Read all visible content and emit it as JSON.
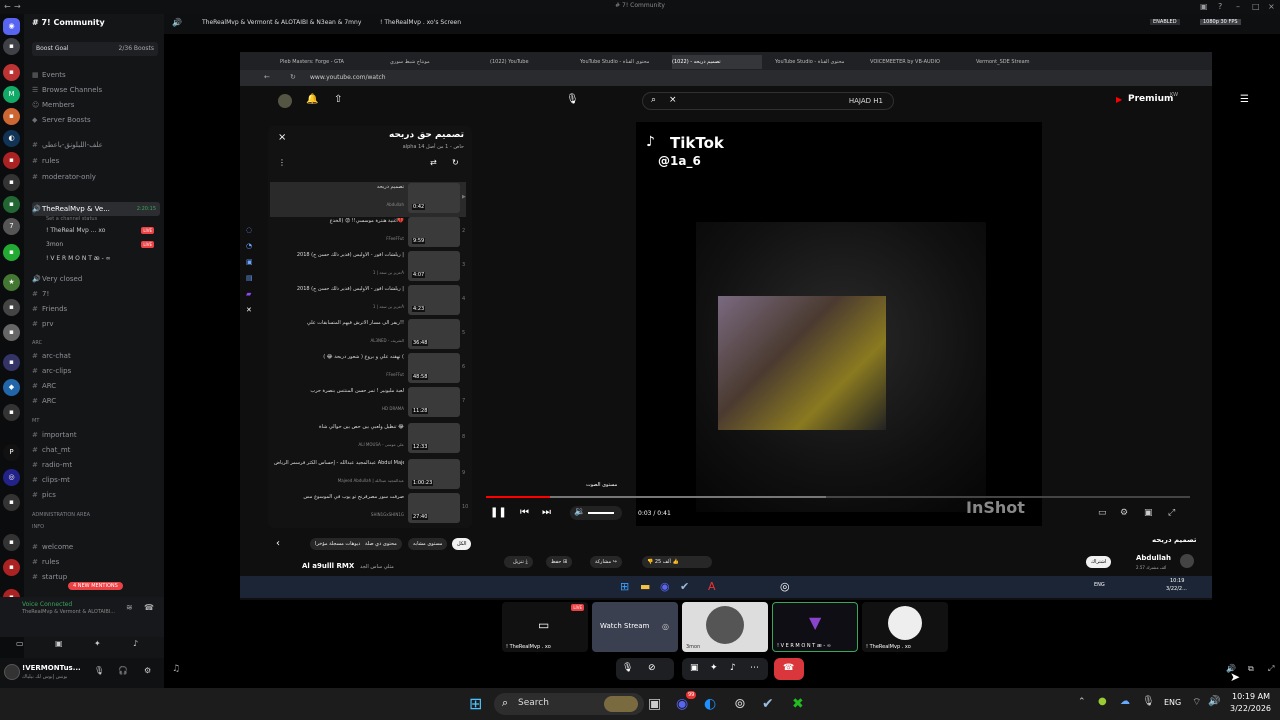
{
  "window": {
    "title": "# 7! Community"
  },
  "sidebar": {
    "guild_name": "# 7! Community",
    "boost_goal": "Boost Goal",
    "boost_count": "2/36 Boosts",
    "items": [
      {
        "label": "Events",
        "sym": "▦"
      },
      {
        "label": "Browse Channels",
        "sym": "☰"
      },
      {
        "label": "Members",
        "sym": "👥"
      },
      {
        "label": "Server Boosts",
        "sym": "◆"
      }
    ],
    "channels_top": [
      "علف-اللبلونق-باعطي",
      "rules",
      "moderator-only"
    ],
    "voice_channel": "TheRealMvp & Ve...",
    "voice_time": "2:20:15",
    "voice_status": "Set a channel status",
    "voice_users": [
      {
        "name": "! TheReal Mvp ... xo",
        "live": "LIVE"
      },
      {
        "name": "3mon",
        "live": "LIVE"
      },
      {
        "name": "! V E R M O N T æ - ∞",
        "live": ""
      }
    ],
    "channels_mid": [
      "Very closed",
      "7!",
      "Friends",
      "prv"
    ],
    "cat_arc": "ARC",
    "channels_arc": [
      "arc-chat",
      "arc-clips",
      "ARC",
      "ARC"
    ],
    "cat_mt": "MT",
    "channels_mt": [
      "important",
      "chat_mt",
      "radio-mt",
      "clips-mt",
      "pics"
    ],
    "cat_admin": "Administration Area",
    "cat_info": "INFO",
    "channels_info": [
      "welcome",
      "rules",
      "startup"
    ],
    "new_mentions": "4 NEW MENTIONS",
    "voice_connected": "Voice Connected",
    "voice_connected_sub": "TheRealMvp & Vermont & ALOTAIBI...",
    "username": "!VERMONTus...",
    "user_status": "بونس إبوس لك نيلياك"
  },
  "topbar": {
    "channel": "TheRealMvp & Vermont & ALOTAIBI & N3ean & 7mny",
    "stream": "! TheRealMvp . xo's Screen",
    "enabled": "ENABLED",
    "quality": "1080p 30 FPS"
  },
  "browser": {
    "tabs": [
      "Pleb Masters: Forge - GTA",
      "مونتاج شبط سوري",
      "(1022) YouTube",
      "YouTube Studio - محتوى القناة",
      "تصميم دربحه - (1022)",
      "YouTube Studio - محتوى القناة",
      "VOICEMEETER by VB-AUDIO",
      "Vermont_SDE Stream"
    ],
    "url": "www.youtube.com/watch",
    "search_text": "HAJAD H1",
    "premium": "Premium",
    "premium_region": "KW"
  },
  "playlist": {
    "title": "تصميم حق دربحه",
    "sub": "alpha حاص - 1 من أصل 14",
    "items": [
      {
        "title": "تصميم دربحه",
        "author": "Abdullah",
        "dur": "0:42",
        "n": "▶"
      },
      {
        "title": "اغنية هنترة موسسي!! 😡 (الخدع💔",
        "author": "FFeeFFut",
        "dur": "9:59",
        "n": "2"
      },
      {
        "title": "ريلشات افور - الاوليس (قدير ذلك حسن ج) 2018 |",
        "author": "عزيز بن سعد | 1A",
        "dur": "4:07",
        "n": "3"
      },
      {
        "title": "ريلشات افور - الاوليس (قدير ذلك حسن ج) 2018 |",
        "author": "عزيز بن سعد | 1A",
        "dur": "4:23",
        "n": "4"
      },
      {
        "title": "ريفر الى مسار الاترش فيهم المتسابقات علي!!",
        "author": "AL3NED - الشريف",
        "dur": "36:48",
        "n": "5"
      },
      {
        "title": "تهقته علي و بروع ( شعور دربحة 😂 ) (",
        "author": "FFeeFFut",
        "dur": "48:58",
        "n": "6"
      },
      {
        "title": "لعبة مليونير ! تمر حسن المنتتس بنصرة حرب",
        "author": "HD DRAMA",
        "dur": "11:28",
        "n": "7"
      },
      {
        "title": "تنظيل ولعبي بين حص بين حوالي شاة 😂",
        "author": "ALI MOUSA - علي موسى",
        "dur": "12:33",
        "n": "8"
      },
      {
        "title": "عبدالمجيد عبدالله - إحساس الكثر فرسمر الرياض Abdul Majeed | 2022 ||",
        "author": "Majeed Abdullah | عبدالمجيد عبدالله",
        "dur": "1:00:23",
        "n": "9"
      },
      {
        "title": "صرفت سور مصرفرنج تو يوب في الموسوع مس",
        "author": "SHIN1GxSHIN1G",
        "dur": "27:40",
        "n": "10"
      }
    ]
  },
  "video": {
    "watermark": "TikTok",
    "handle": "@1a_6",
    "inshot": "InShot",
    "time": "0:03 / 0:41",
    "volume_tip": "مستوى الصوت"
  },
  "below": {
    "chips": [
      "الكل",
      "مستوى مشابه",
      "محتوى ذي صلة",
      "فيديوهات مسجلة مؤخرا"
    ],
    "next_title": "Al a9ulll RMX",
    "next_sub": "مثلي ساس الجد",
    "more": "...",
    "download": "تنزيل",
    "save": "حفظ",
    "share": "مشاركة",
    "likes": "25 ألف",
    "subscribe": "اشتراك",
    "channel": "Abdullah",
    "channel_subs": "2.57 ألف مشترك",
    "video_title": "تصميم دربحه"
  },
  "win_taskbar": {
    "lang": "ENG",
    "time": "10:19",
    "date": "3/22/2..."
  },
  "streams": {
    "tiles": [
      {
        "name": "! TheRealMvp . xo",
        "live": "LIVE"
      },
      {
        "name": "Watch Stream",
        "live": ""
      },
      {
        "name": "3mon",
        "live": ""
      },
      {
        "name": "! V E R M O N T æ - ∞",
        "live": ""
      },
      {
        "name": "! TheRealMvp . xo",
        "live": ""
      }
    ]
  },
  "taskbar": {
    "search": "Search",
    "lang": "ENG",
    "time": "10:19 AM",
    "date": "3/22/2026",
    "badge": "99"
  }
}
